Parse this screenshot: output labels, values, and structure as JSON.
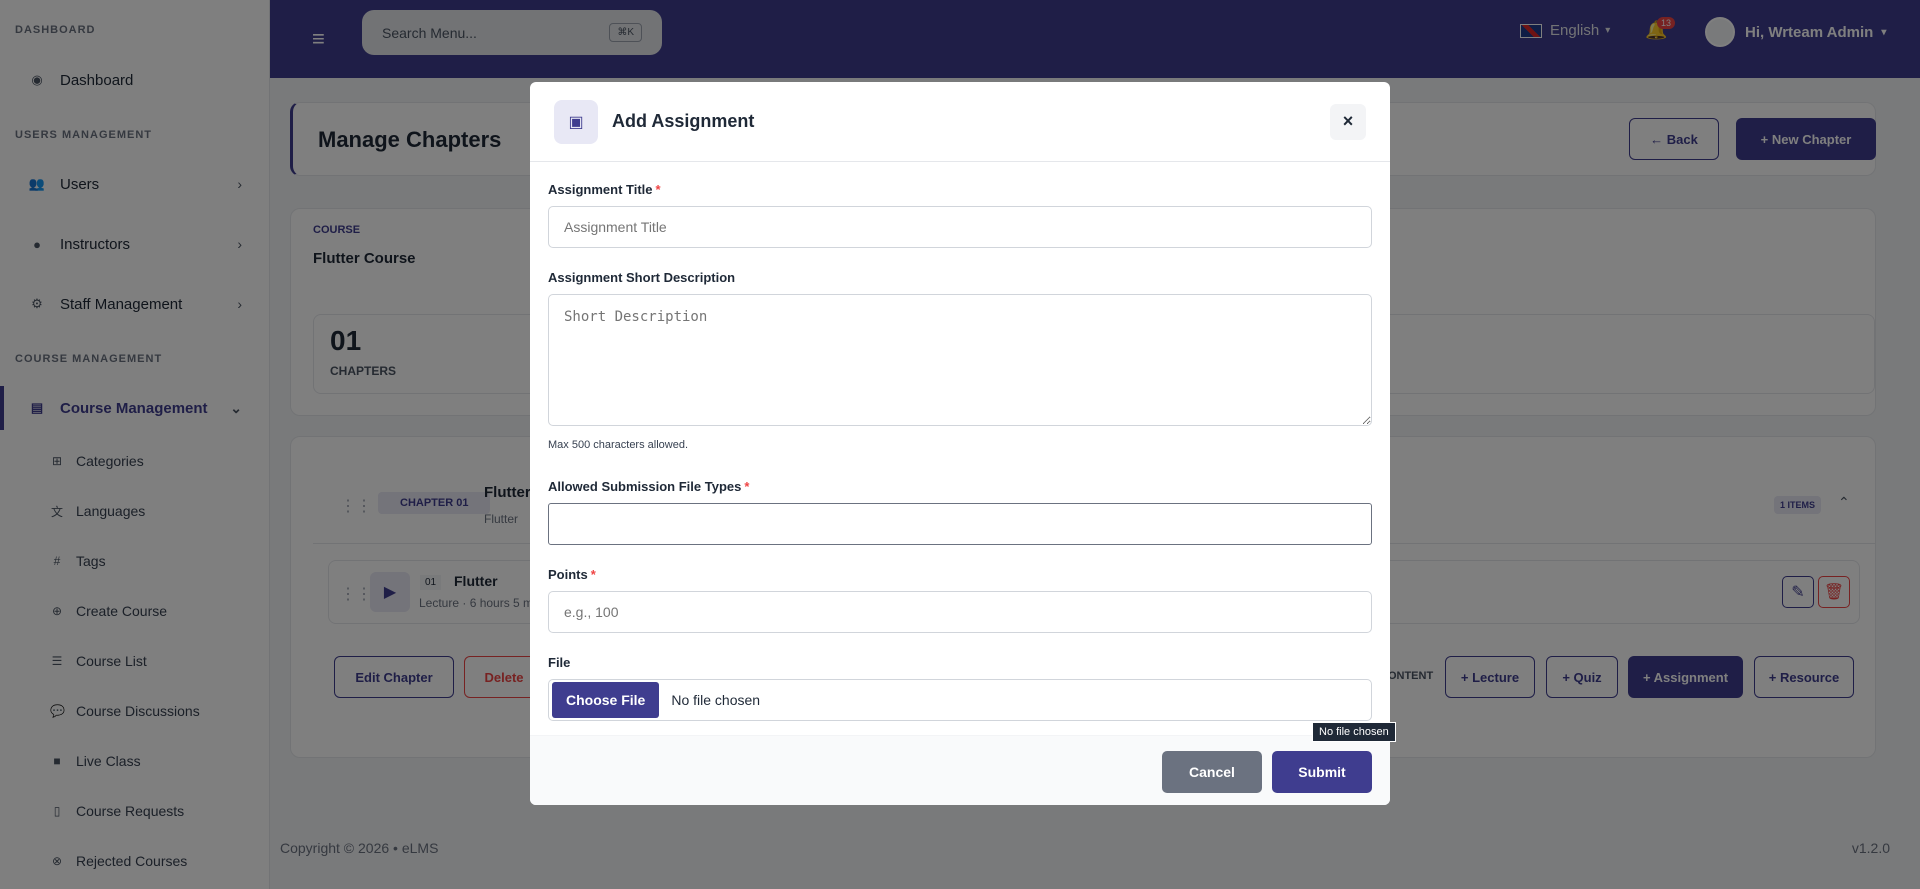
{
  "sidebar": {
    "sections": [
      "DASHBOARD",
      "USERS MANAGEMENT",
      "COURSE MANAGEMENT"
    ],
    "dashboard": "Dashboard",
    "users": "Users",
    "instructors": "Instructors",
    "staff": "Staff Management",
    "course_mgmt": "Course Management",
    "subitems": [
      "Categories",
      "Languages",
      "Tags",
      "Create Course",
      "Course List",
      "Course Discussions",
      "Live Class",
      "Course Requests",
      "Rejected Courses"
    ]
  },
  "topbar": {
    "search_placeholder": "Search Menu...",
    "shortcut": "⌘K",
    "language": "English",
    "notif_count": "13",
    "user": "Hi, Wrteam Admin"
  },
  "page": {
    "title": "Manage Chapters",
    "back": "← Back",
    "new_chapter": "+ New Chapter",
    "course_label": "COURSE",
    "course_name": "Flutter Course",
    "chapters_count": "01",
    "chapters_label": "CHAPTERS",
    "chapter_badge": "CHAPTER 01",
    "chapter_title": "Flutter",
    "chapter_sub": "Flutter",
    "items_badge": "1 ITEMS",
    "lecture_num": "01",
    "lecture_title": "Flutter",
    "lecture_meta": "Lecture · 6 hours 5 m",
    "edit_chapter": "Edit Chapter",
    "delete": "Delete",
    "content_label": "CONTENT",
    "add_lecture": "+ Lecture",
    "add_quiz": "+ Quiz",
    "add_assignment": "+ Assignment",
    "add_resource": "+ Resource"
  },
  "modal": {
    "title": "Add Assignment",
    "close": "×",
    "title_label": "Assignment Title",
    "title_placeholder": "Assignment Title",
    "desc_label": "Assignment Short Description",
    "desc_placeholder": "Short Description",
    "desc_help": "Max 500 characters allowed.",
    "types_label": "Allowed Submission File Types",
    "points_label": "Points",
    "points_placeholder": "e.g., 100",
    "file_label": "File",
    "file_button": "Choose File",
    "file_text": "No file chosen",
    "tooltip": "No file chosen",
    "cancel": "Cancel",
    "submit": "Submit"
  },
  "footer": {
    "copyright": "Copyright © 2026  •  eLMS",
    "version": "v1.2.0"
  },
  "colors": {
    "primary": "#3f3d8f",
    "danger": "#ef4444"
  }
}
